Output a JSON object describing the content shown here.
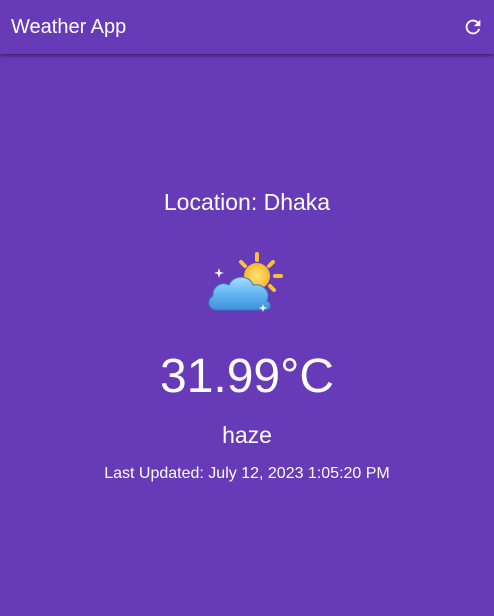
{
  "app_bar": {
    "title": "Weather App",
    "refresh_icon": "refresh-icon"
  },
  "weather": {
    "location": "Location: Dhaka",
    "icon": "partly-cloudy-icon",
    "temperature": "31.99°C",
    "condition": "haze",
    "last_updated": "Last Updated: July 12, 2023 1:05:20 PM"
  },
  "colors": {
    "background": "#673ab7",
    "text": "#ffffff"
  }
}
